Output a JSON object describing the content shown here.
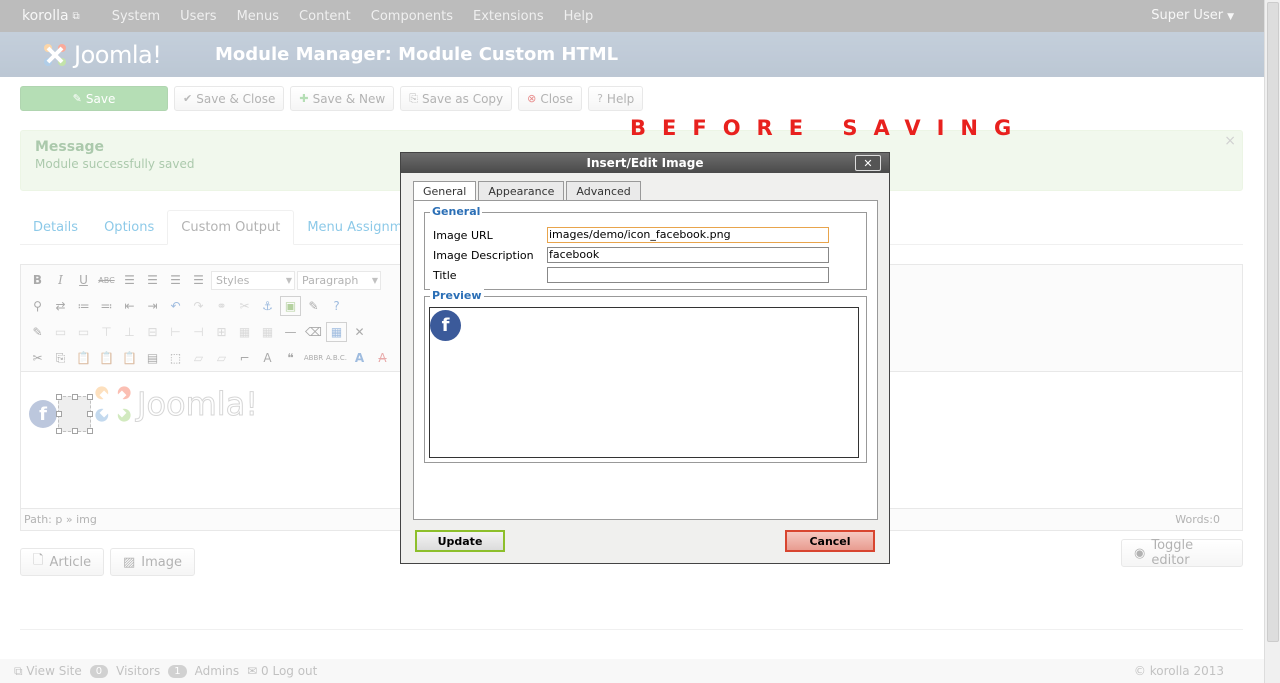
{
  "navbar": {
    "brand": "korolla",
    "items": [
      "System",
      "Users",
      "Menus",
      "Content",
      "Components",
      "Extensions",
      "Help"
    ],
    "user": "Super User"
  },
  "header": {
    "logo_text": "Joomla!",
    "title": "Module Manager: Module Custom HTML"
  },
  "toolbar": {
    "save": "Save",
    "save_close": "Save & Close",
    "save_new": "Save & New",
    "save_copy": "Save as Copy",
    "close": "Close",
    "help": "Help"
  },
  "annotation": "BEFORE SAVING",
  "message": {
    "title": "Message",
    "text": "Module successfully saved",
    "close": "×"
  },
  "tabs": [
    "Details",
    "Options",
    "Custom Output",
    "Menu Assignment"
  ],
  "active_tab": "Custom Output",
  "editor": {
    "styles_label": "Styles",
    "format_label": "Paragraph",
    "fb_glyph": "f",
    "content_logo_text": "Joomla!",
    "path": "Path: p » img",
    "words": "Words:0"
  },
  "lower_buttons": {
    "article": "Article",
    "image": "Image",
    "toggle": "Toggle editor"
  },
  "status": {
    "view_site": "View Site",
    "visitors_count": "0",
    "visitors": "Visitors",
    "admins_count": "1",
    "admins": "Admins",
    "logout_count": "0",
    "logout": "Log out",
    "copyright": "© korolla 2013"
  },
  "modal": {
    "title": "Insert/Edit Image",
    "close": "✕",
    "tabs": [
      "General",
      "Appearance",
      "Advanced"
    ],
    "general_legend": "General",
    "fields": {
      "image_url_label": "Image URL",
      "image_url_value": "images/demo/icon_facebook.png",
      "description_label": "Image Description",
      "description_value": "facebook",
      "title_label": "Title",
      "title_value": ""
    },
    "preview_legend": "Preview",
    "preview_glyph": "f",
    "update": "Update",
    "cancel": "Cancel"
  },
  "colors": {
    "navbar": "#6b6b6b",
    "header": "#7590ab",
    "save_green": "#5bb75b",
    "message_bg": "#dff0d8",
    "annotation_red": "#e8211e",
    "facebook_blue": "#3b5a9a",
    "link_blue": "#0088cc"
  }
}
